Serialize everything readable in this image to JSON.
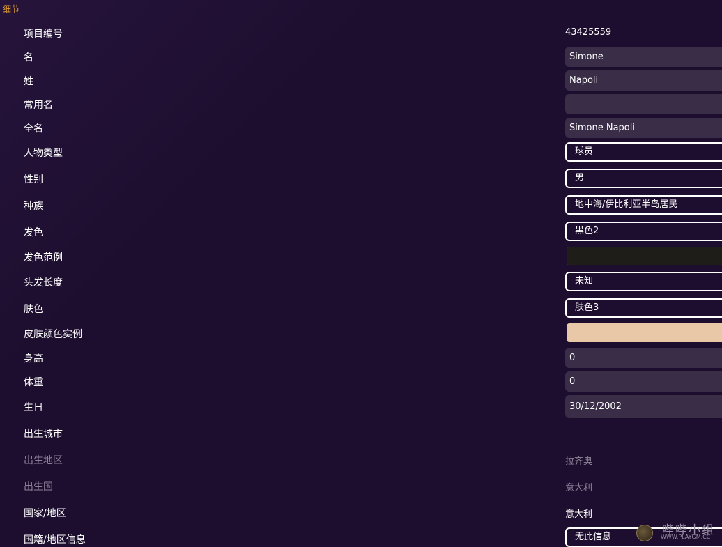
{
  "section": {
    "title": "细节"
  },
  "fields": {
    "project_id": {
      "label": "项目编号",
      "value": "43425559"
    },
    "first_name": {
      "label": "名",
      "value": "Simone"
    },
    "last_name": {
      "label": "姓",
      "value": "Napoli"
    },
    "common_name": {
      "label": "常用名",
      "value": ""
    },
    "full_name": {
      "label": "全名",
      "value": "Simone Napoli"
    },
    "person_type": {
      "label": "人物类型",
      "value": "球员"
    },
    "gender": {
      "label": "性别",
      "value": "男"
    },
    "ethnicity": {
      "label": "种族",
      "value": "地中海/伊比利亚半岛居民"
    },
    "hair_color": {
      "label": "发色",
      "value": "黑色2"
    },
    "hair_color_sample": {
      "label": "发色范例",
      "color": "#1e1d17"
    },
    "hair_length": {
      "label": "头发长度",
      "value": "未知"
    },
    "skin_color": {
      "label": "肤色",
      "value": "肤色3"
    },
    "skin_color_sample": {
      "label": "皮肤颜色实例",
      "color": "#e8c8a6"
    },
    "height": {
      "label": "身高",
      "value": "0"
    },
    "weight": {
      "label": "体重",
      "value": "0"
    },
    "birthday": {
      "label": "生日",
      "value": "30/12/2002"
    },
    "birth_city": {
      "label": "出生城市",
      "value": ""
    },
    "birth_region": {
      "label": "出生地区",
      "value": "拉齐奥"
    },
    "birth_country": {
      "label": "出生国",
      "value": "意大利"
    },
    "nation": {
      "label": "国家/地区",
      "value": "意大利"
    },
    "nationality_info": {
      "label": "国籍/地区信息",
      "value": "无此信息"
    }
  },
  "watermark": {
    "title": "哔哔小组",
    "url": "WWW.PLAYGM.CC"
  },
  "colors": {
    "accent": "#e8a62c",
    "background": "#1d0e2f",
    "input_bg": "#3a2d48"
  }
}
